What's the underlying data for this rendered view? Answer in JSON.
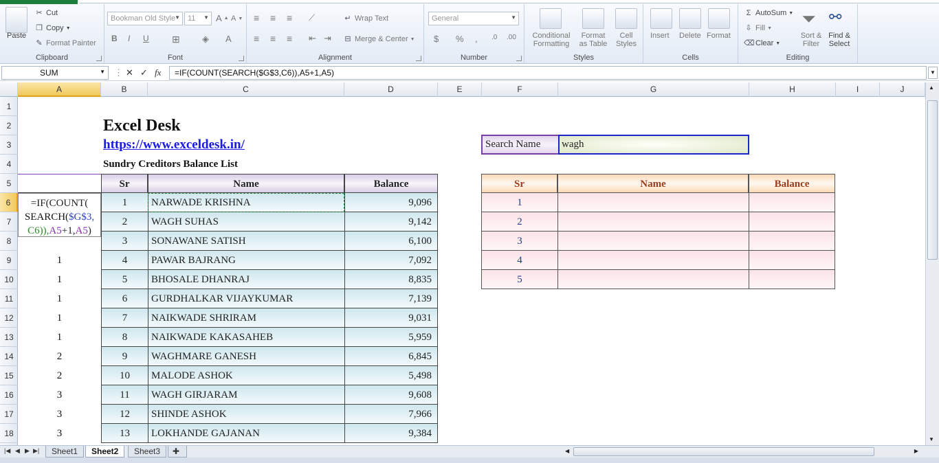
{
  "ribbon": {
    "clipboard": {
      "title": "Clipboard",
      "paste": "Paste",
      "cut": "Cut",
      "copy": "Copy",
      "format_painter": "Format Painter"
    },
    "font": {
      "title": "Font",
      "font_name": "Bookman Old Style",
      "font_size": "11"
    },
    "alignment": {
      "title": "Alignment",
      "wrap_text": "Wrap Text",
      "merge_center": "Merge & Center"
    },
    "number": {
      "title": "Number",
      "format": "General"
    },
    "styles": {
      "title": "Styles",
      "conditional_1": "Conditional",
      "conditional_2": "Formatting",
      "format_table_1": "Format",
      "format_table_2": "as Table",
      "cell_styles_1": "Cell",
      "cell_styles_2": "Styles"
    },
    "cells": {
      "title": "Cells",
      "insert": "Insert",
      "delete": "Delete",
      "format": "Format"
    },
    "editing": {
      "title": "Editing",
      "autosum": "AutoSum",
      "fill": "Fill",
      "clear": "Clear",
      "sort_1": "Sort &",
      "sort_2": "Filter",
      "find_1": "Find &",
      "find_2": "Select"
    }
  },
  "formula_bar": {
    "name_box": "SUM",
    "formula": "=IF(COUNT(SEARCH($G$3,C6)),A5+1,A5)"
  },
  "columns": [
    "A",
    "B",
    "C",
    "D",
    "E",
    "F",
    "G",
    "H",
    "I",
    "J"
  ],
  "rows": [
    "1",
    "2",
    "3",
    "4",
    "5",
    "6",
    "7",
    "8",
    "9",
    "10",
    "11",
    "12",
    "13",
    "14",
    "15",
    "16",
    "17",
    "18"
  ],
  "sheet": {
    "title": "Excel Desk",
    "link": "https://www.exceldesk.in/",
    "subtitle": "Sundry Creditors Balance List",
    "edit_formula_parts": [
      "=IF(COUNT(",
      "SEARCH(",
      "$G$3,",
      "C6)),",
      "A5",
      "+1,",
      "A5",
      ")"
    ],
    "helper_values": [
      "1",
      "1",
      "1",
      "1",
      "1",
      "2",
      "2",
      "3",
      "3",
      "3"
    ],
    "main_table": {
      "headers": [
        "Sr",
        "Name",
        "Balance"
      ],
      "rows": [
        [
          "1",
          "NARWADE KRISHNA",
          "9,096"
        ],
        [
          "2",
          "WAGH SUHAS",
          "9,142"
        ],
        [
          "3",
          "SONAWANE SATISH",
          "6,100"
        ],
        [
          "4",
          "PAWAR BAJRANG",
          "7,092"
        ],
        [
          "5",
          "BHOSALE DHANRAJ",
          "8,835"
        ],
        [
          "6",
          "GURDHALKAR VIJAYKUMAR",
          "7,139"
        ],
        [
          "7",
          "NAIKWADE SHRIRAM",
          "9,031"
        ],
        [
          "8",
          "NAIKWADE KAKASAHEB",
          "5,959"
        ],
        [
          "9",
          "WAGHMARE GANESH",
          "6,845"
        ],
        [
          "10",
          "MALODE ASHOK",
          "5,498"
        ],
        [
          "11",
          "WAGH GIRJARAM",
          "9,608"
        ],
        [
          "12",
          "SHINDE ASHOK",
          "7,966"
        ],
        [
          "13",
          "LOKHANDE GAJANAN",
          "9,384"
        ]
      ]
    },
    "search": {
      "label": "Search Name",
      "value": "wagh"
    },
    "result_table": {
      "headers": [
        "Sr",
        "Name",
        "Balance"
      ],
      "rows": [
        "1",
        "2",
        "3",
        "4",
        "5"
      ]
    }
  },
  "sheet_tabs": [
    "Sheet1",
    "Sheet2",
    "Sheet3"
  ],
  "active_tab": "Sheet2",
  "colors": {
    "accent_green": "#1e7f3c",
    "selection": "#f2c85a",
    "header_purple": "#d8cde6",
    "row_blue": "#cfe7ee",
    "result_header": "#fbd9b7",
    "result_row": "#fbe3e6"
  }
}
